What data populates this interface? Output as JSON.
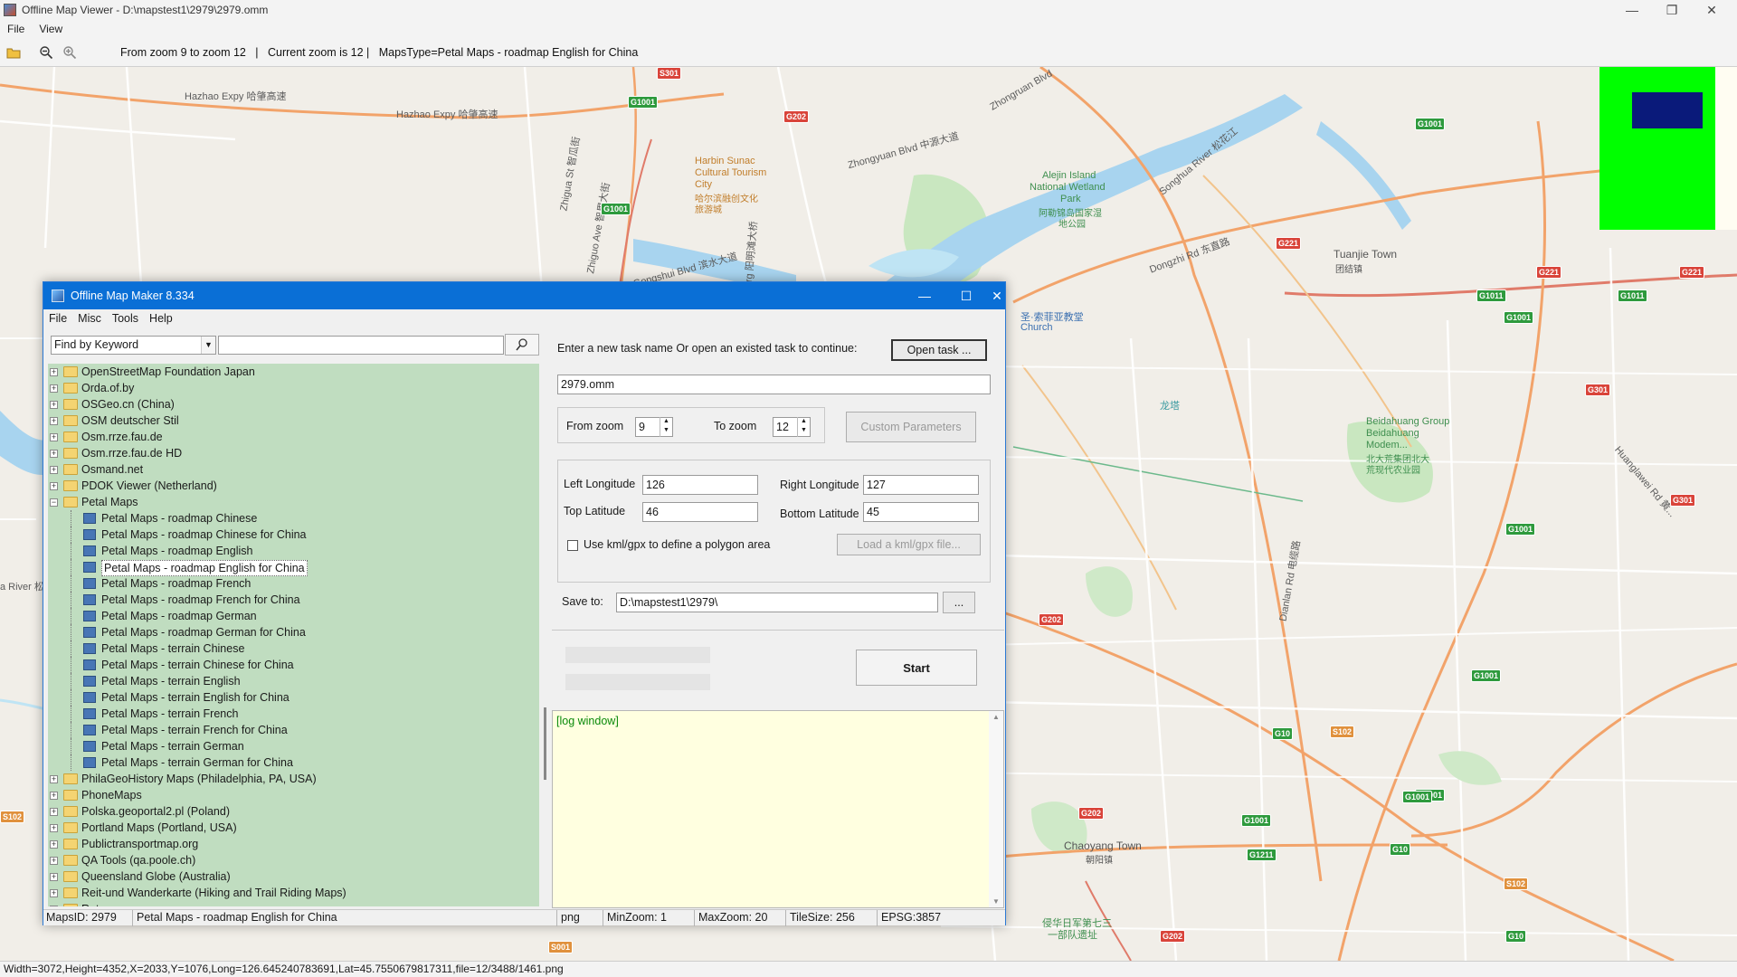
{
  "window": {
    "title": "Offline Map Viewer - D:\\mapstest1\\2979\\2979.omm",
    "menu": [
      "File",
      "View"
    ]
  },
  "toolbar": {
    "info": "  From zoom 9 to zoom 12   |   Current zoom is 12 |   MapsType=Petal Maps - roadmap English for China"
  },
  "map": {
    "labels": [
      {
        "text": "Hazhao Expy 哈肇高速",
        "kind": "road"
      },
      {
        "text": "Hazhao Expy 哈肇高速",
        "kind": "road"
      },
      {
        "text": "Zhongruan Blvd",
        "kind": "road"
      },
      {
        "text": "Zhongyuan Blvd 中源大道",
        "kind": "road"
      },
      {
        "text": "Songhua River 松花江",
        "kind": "road"
      },
      {
        "text": "Harbin Sunac",
        "kind": "poi"
      },
      {
        "text": "Cultural Tourism",
        "kind": "poi"
      },
      {
        "text": "City",
        "kind": "poi"
      },
      {
        "text": "哈尔滨融创文化",
        "kind": "poi"
      },
      {
        "text": "旅游城",
        "kind": "poi"
      },
      {
        "text": "Alejin Island",
        "kind": "park"
      },
      {
        "text": "National Wetland",
        "kind": "park"
      },
      {
        "text": "Park",
        "kind": "park"
      },
      {
        "text": "阿勒锦岛国家湿",
        "kind": "park"
      },
      {
        "text": "地公园",
        "kind": "park"
      },
      {
        "text": "Dongzhi Rd 东直路",
        "kind": "road"
      },
      {
        "text": "Tuanjie Town",
        "kind": "town"
      },
      {
        "text": "团结镇",
        "kind": "town"
      },
      {
        "text": "圣·索菲亚教堂",
        "kind": "poi"
      },
      {
        "text": "Church",
        "kind": "poi"
      },
      {
        "text": "龙塔",
        "kind": "poi"
      },
      {
        "text": "Beidahuang Group",
        "kind": "park"
      },
      {
        "text": "Beidahuang",
        "kind": "park"
      },
      {
        "text": "Modem...",
        "kind": "park"
      },
      {
        "text": "北大荒集团北大",
        "kind": "park"
      },
      {
        "text": "荒现代农业园",
        "kind": "park"
      },
      {
        "text": "Chaoyang Town",
        "kind": "town"
      },
      {
        "text": "朝阳镇",
        "kind": "town"
      },
      {
        "text": "侵华日军第七三",
        "kind": "park"
      },
      {
        "text": "一部队遗址",
        "kind": "park"
      },
      {
        "text": "Huanglawei Rd 黄...",
        "kind": "road"
      },
      {
        "text": "Dianlan Rd 电缆路",
        "kind": "road"
      },
      {
        "text": "a River 松",
        "kind": "road"
      },
      {
        "text": "Zhigua St 智瓜街",
        "kind": "road"
      },
      {
        "text": "Zhiguo Ave 智果大街",
        "kind": "road"
      },
      {
        "text": "Gongshui Blvd 滨水大道",
        "kind": "road"
      },
      {
        "text": "Xingtan Brg 阳明滩大桥",
        "kind": "road"
      }
    ],
    "shields": [
      "S301",
      "G1001",
      "G202",
      "G1001",
      "G1001",
      "G221",
      "G221",
      "G221",
      "G1011",
      "G1011",
      "G1001",
      "G301",
      "G1001",
      "G301",
      "G1001",
      "G202",
      "G1001",
      "G10",
      "S102",
      "G1001",
      "G1001",
      "G1211",
      "G10",
      "S102",
      "G202",
      "S001",
      "G10",
      "S102",
      "G202"
    ]
  },
  "status_bar": "Width=3072,Height=4352,X=2033,Y=1076,Long=126.645240783691,Lat=45.7550679817311,file=12/3488/1461.png",
  "dialog": {
    "title": "Offline Map Maker 8.334",
    "menu": [
      "File",
      "Misc",
      "Tools",
      "Help"
    ],
    "search_mode": "Find by Keyword",
    "search_value": "",
    "tree": [
      {
        "label": "OpenStreetMap Foundation Japan",
        "type": "folder",
        "expanded": false
      },
      {
        "label": "Orda.of.by",
        "type": "folder",
        "expanded": false
      },
      {
        "label": "OSGeo.cn (China)",
        "type": "folder",
        "expanded": false
      },
      {
        "label": "OSM deutscher Stil",
        "type": "folder",
        "expanded": false
      },
      {
        "label": "Osm.rrze.fau.de",
        "type": "folder",
        "expanded": false
      },
      {
        "label": "Osm.rrze.fau.de HD",
        "type": "folder",
        "expanded": false
      },
      {
        "label": "Osmand.net",
        "type": "folder",
        "expanded": false
      },
      {
        "label": "PDOK Viewer (Netherland)",
        "type": "folder",
        "expanded": false
      },
      {
        "label": "Petal Maps",
        "type": "folder",
        "expanded": true
      },
      {
        "label": "Petal Maps - roadmap Chinese",
        "type": "leaf"
      },
      {
        "label": "Petal Maps - roadmap Chinese for China",
        "type": "leaf"
      },
      {
        "label": "Petal Maps - roadmap English",
        "type": "leaf"
      },
      {
        "label": "Petal Maps - roadmap English for China",
        "type": "leaf",
        "selected": true
      },
      {
        "label": "Petal Maps - roadmap French",
        "type": "leaf"
      },
      {
        "label": "Petal Maps - roadmap French for China",
        "type": "leaf"
      },
      {
        "label": "Petal Maps - roadmap German",
        "type": "leaf"
      },
      {
        "label": "Petal Maps - roadmap German for China",
        "type": "leaf"
      },
      {
        "label": "Petal Maps - terrain Chinese",
        "type": "leaf"
      },
      {
        "label": "Petal Maps - terrain Chinese for China",
        "type": "leaf"
      },
      {
        "label": "Petal Maps - terrain English",
        "type": "leaf"
      },
      {
        "label": "Petal Maps - terrain English for China",
        "type": "leaf"
      },
      {
        "label": "Petal Maps - terrain French",
        "type": "leaf"
      },
      {
        "label": "Petal Maps - terrain French for China",
        "type": "leaf"
      },
      {
        "label": "Petal Maps - terrain German",
        "type": "leaf"
      },
      {
        "label": "Petal Maps - terrain German for China",
        "type": "leaf"
      },
      {
        "label": "PhilaGeoHistory Maps (Philadelphia, PA, USA)",
        "type": "folder",
        "expanded": false
      },
      {
        "label": "PhoneMaps",
        "type": "folder",
        "expanded": false
      },
      {
        "label": "Polska.geoportal2.pl (Poland)",
        "type": "folder",
        "expanded": false
      },
      {
        "label": "Portland Maps (Portland, USA)",
        "type": "folder",
        "expanded": false
      },
      {
        "label": "Publictransportmap.org",
        "type": "folder",
        "expanded": false
      },
      {
        "label": "QA Tools (qa.poole.ch)",
        "type": "folder",
        "expanded": false
      },
      {
        "label": "Queensland Globe (Australia)",
        "type": "folder",
        "expanded": false
      },
      {
        "label": "Reit-und Wanderkarte (Hiking and Trail Riding Maps)",
        "type": "folder",
        "expanded": false
      },
      {
        "label": "Retromap.ru",
        "type": "folder",
        "expanded": false
      }
    ],
    "task": {
      "prompt": "Enter a new task name Or open an existed task to continue:",
      "open_button": "Open task ...",
      "name": "2979.omm"
    },
    "zoom": {
      "from_label": "From zoom",
      "from_value": "9",
      "to_label": "To zoom",
      "to_value": "12",
      "custom_button": "Custom Parameters"
    },
    "area": {
      "left_label": "Left Longitude",
      "left_value": "126",
      "right_label": "Right Longitude",
      "right_value": "127",
      "top_label": "Top Latitude",
      "top_value": "46",
      "bottom_label": "Bottom Latitude",
      "bottom_value": "45",
      "kml_checkbox_label": "Use kml/gpx to define a polygon area",
      "kml_checked": false,
      "kml_button": "Load a kml/gpx file..."
    },
    "save": {
      "label": "Save to:",
      "path": "D:\\mapstest1\\2979\\",
      "browse_button": "..."
    },
    "start_button": "Start",
    "log_text": "[log window]",
    "status": {
      "maps_id": "MapsID: 2979",
      "maps_name": "Petal Maps - roadmap English for China",
      "format": "png",
      "min_zoom": "MinZoom: 1",
      "max_zoom": "MaxZoom: 20",
      "tile_size": "TileSize: 256",
      "epsg": "EPSG:3857"
    }
  }
}
